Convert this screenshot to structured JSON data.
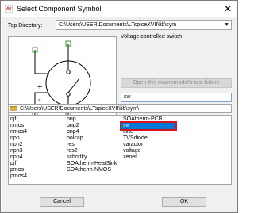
{
  "window": {
    "title": "Select Component Symbol",
    "close_glyph": "✕"
  },
  "top_directory": {
    "label": "Top Directory:",
    "value": "C:\\Users\\USER\\Documents\\LTspiceXVII\\lib\\sym"
  },
  "preview": {
    "symbol": "voltage-controlled-switch",
    "plus_sign": "+",
    "minus_sign": "-"
  },
  "description": "Voltage controlled switch",
  "fixture_button": "Open this macromodel's test fixture",
  "search": {
    "value": "sw"
  },
  "current_path": "C:\\Users\\USER\\Documents\\LTspiceXVII\\lib\\sym\\",
  "components": [
    [
      "njf",
      "nmos",
      "nmos4",
      "npn",
      "npn2",
      "npn3",
      "npn4",
      "pjf",
      "pmos",
      "pmos4"
    ],
    [
      "pnp",
      "pnp2",
      "pnp4",
      "polcap",
      "res",
      "res2",
      "schottky",
      "SOAtherm-HeatSink",
      "SOAtherm-NMOS"
    ],
    [
      "SOAtherm-PCB",
      "sw",
      "tline",
      "TVSdiode",
      "varactor",
      "voltage",
      "zener"
    ]
  ],
  "selected_component": "sw",
  "buttons": {
    "cancel": "Cancel",
    "ok": "OK"
  },
  "colors": {
    "selection": "#0078d7",
    "selection_outline": "#d9121a",
    "wire": "#000000",
    "pin": "#2e9a2e"
  }
}
